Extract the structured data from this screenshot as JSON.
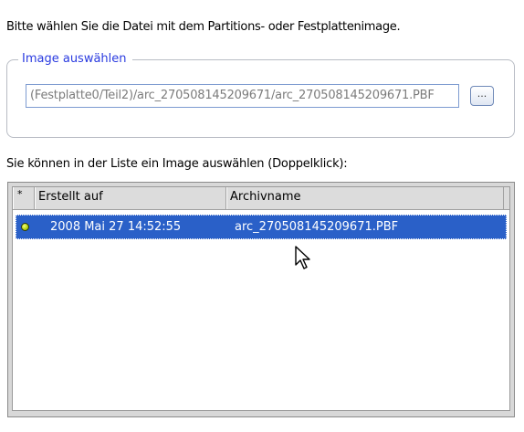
{
  "intro_text": "Bitte wählen Sie die Datei mit dem Partitions- oder Festplattenimage.",
  "image_group": {
    "legend": "Image auswählen",
    "path_value": "(Festplatte0/Teil2)/arc_270508145209671/arc_270508145209671.PBF",
    "browse_button_label": "..."
  },
  "list_caption": "Sie können in der Liste ein Image auswählen (Doppelklick):",
  "image_list": {
    "columns": [
      "*",
      "Erstellt auf",
      "Archivname"
    ],
    "rows": [
      {
        "status_icon": "green-dot-icon",
        "created": "2008 Mai 27 14:52:55",
        "archive_name": "arc_270508145209671.PBF",
        "selected": true
      }
    ]
  },
  "colors": {
    "legend": "#2a3be0",
    "selection": "#2a60c8"
  },
  "icons": {
    "browse": "ellipsis",
    "cursor": "mouse-pointer-icon"
  }
}
